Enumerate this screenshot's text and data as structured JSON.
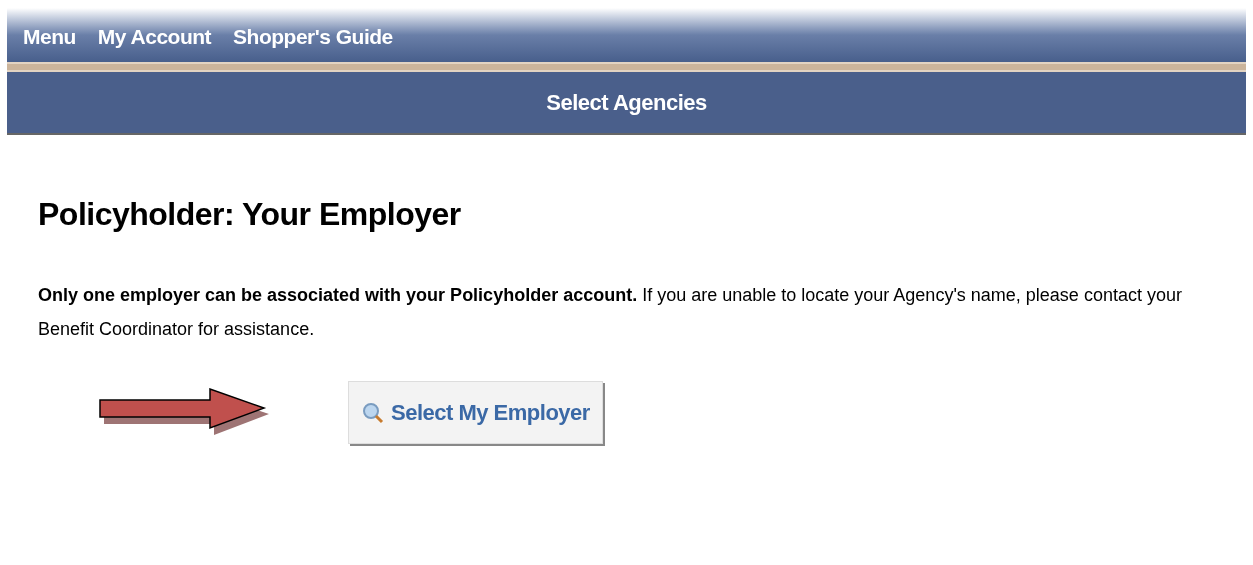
{
  "nav": {
    "items": [
      "Menu",
      "My Account",
      "Shopper's Guide"
    ]
  },
  "banner": {
    "title": "Select Agencies"
  },
  "heading": "Policyholder: Your Employer",
  "message": "**Only one employer can be associated with your Policyholder account.** If you are unable to locate your Agency's name, please contact your Benefit Coordinator for assistance.",
  "button": {
    "label": "Select My Employer"
  }
}
